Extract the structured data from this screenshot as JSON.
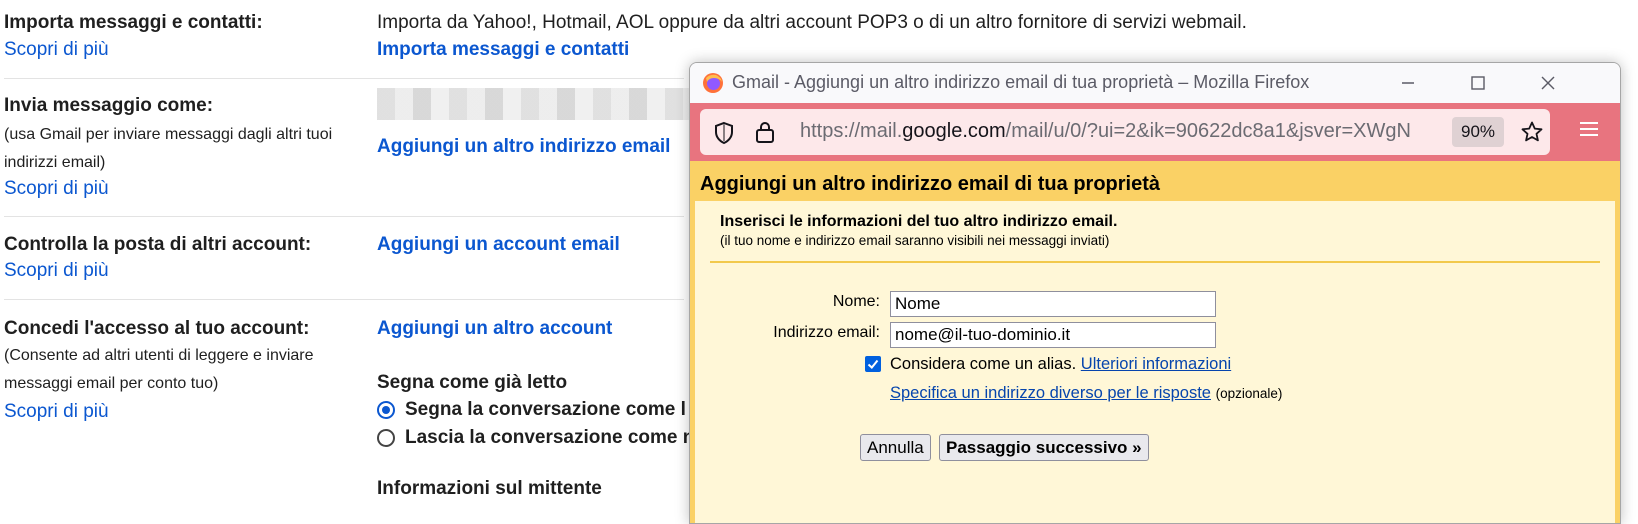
{
  "settings": {
    "import": {
      "label": "Importa messaggi e contatti:",
      "more": "Scopri di più",
      "description": "Importa da Yahoo!, Hotmail, AOL oppure da altri account POP3 o di un altro fornitore di servizi webmail.",
      "action": "Importa messaggi e contatti"
    },
    "send_as": {
      "label": "Invia messaggio come:",
      "sub": "(usa Gmail per inviare messaggi dagli altri tuoi indirizzi email)",
      "more": "Scopri di più",
      "action": "Aggiungi un altro indirizzo email"
    },
    "check_mail": {
      "label": "Controlla la posta di altri account:",
      "more": "Scopri di più",
      "action": "Aggiungi un account email"
    },
    "grant_access": {
      "label": "Concedi l'accesso al tuo account:",
      "sub": "(Consente ad altri utenti di leggere e inviare messaggi email per conto tuo)",
      "more": "Scopri di più",
      "action": "Aggiungi un altro account",
      "mark_read_heading": "Segna come già letto",
      "radio_1": "Segna la conversazione come l",
      "radio_2": "Lascia la conversazione come n",
      "sender_info_heading": "Informazioni sul mittente"
    }
  },
  "popup": {
    "window_title": "Gmail - Aggiungi un altro indirizzo email di tua proprietà – Mozilla Firefox",
    "url_prefix": "https://mail.",
    "url_domain": "google.com",
    "url_rest": "/mail/u/0/?ui=2&ik=90622dc8a1&jsver=XWgN",
    "zoom": "90%",
    "dialog": {
      "title": "Aggiungi un altro indirizzo email di tua proprietà",
      "intro": "Inserisci le informazioni del tuo altro indirizzo email.",
      "intro_sub": "(il tuo nome e indirizzo email saranno visibili nei messaggi inviati)",
      "name_label": "Nome:",
      "name_value": "Nome",
      "email_label": "Indirizzo email:",
      "email_value": "nome@il-tuo-dominio.it",
      "alias_label": "Considera come un alias.",
      "alias_link": "Ulteriori informazioni",
      "alias_checked": true,
      "reply_link": "Specifica un indirizzo diverso per le risposte",
      "reply_optional": "(opzionale)",
      "cancel_button": "Annulla",
      "next_button": "Passaggio successivo »"
    }
  },
  "colors": {
    "link_blue": "#0b57d0",
    "dialog_header": "#fad165",
    "dialog_body": "#fff7d7",
    "url_bar": "#e8747f"
  }
}
